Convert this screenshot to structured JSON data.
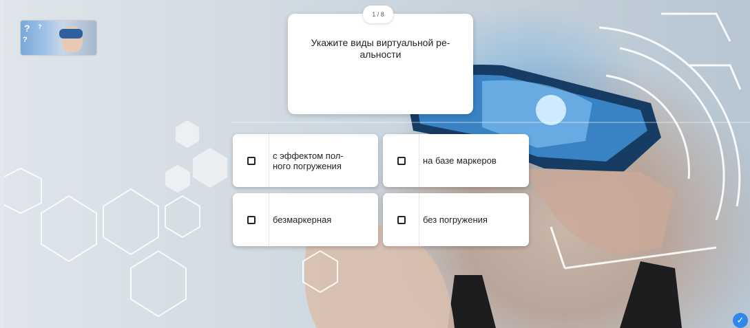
{
  "quiz": {
    "counter": "1 / 8",
    "question": "Укажите виды виртуальной ре-\nальности",
    "answers": [
      {
        "label": "с эффектом пол-\nного погружения"
      },
      {
        "label": "на базе маркеров"
      },
      {
        "label": "безмаркерная"
      },
      {
        "label": "без погружения"
      }
    ]
  },
  "icons": {
    "thumbnail": "vr-thumbnail-image",
    "checkbox": "checkbox-icon",
    "check": "check-icon"
  },
  "colors": {
    "accent": "#2f88e8",
    "card": "#ffffff",
    "text": "#222222"
  }
}
